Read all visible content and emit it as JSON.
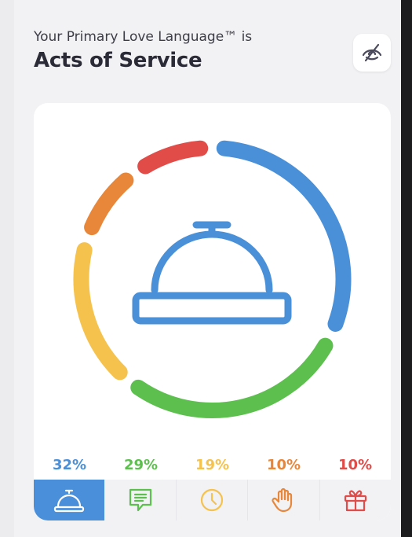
{
  "header": {
    "subtitle": "Your Primary Love Language™ is",
    "title": "Acts of Service"
  },
  "hide_button": {
    "icon": "eye-off-icon"
  },
  "chart_data": {
    "type": "pie",
    "center_icon": "service-bell-icon",
    "slices": [
      {
        "label": "Acts of Service",
        "value": 32,
        "display": "32%",
        "color": "#4a90d9",
        "icon": "service-bell-icon"
      },
      {
        "label": "Words of Affirmation",
        "value": 29,
        "display": "29%",
        "color": "#5cbf4e",
        "icon": "chat-icon"
      },
      {
        "label": "Quality Time",
        "value": 19,
        "display": "19%",
        "color": "#f5c24e",
        "icon": "clock-icon"
      },
      {
        "label": "Physical Touch",
        "value": 10,
        "display": "10%",
        "color": "#e8873a",
        "icon": "hand-icon"
      },
      {
        "label": "Receiving Gifts",
        "value": 10,
        "display": "10%",
        "color": "#e14b48",
        "icon": "gift-icon"
      }
    ]
  },
  "tabs": {
    "active_index": 0
  }
}
